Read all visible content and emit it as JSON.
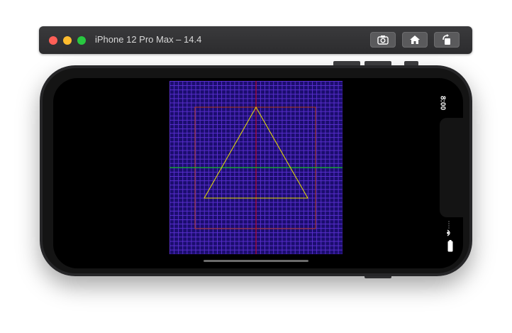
{
  "window": {
    "title": "iPhone 12 Pro Max – 14.4",
    "toolbar": {
      "screenshot_icon": "camera-icon",
      "home_icon": "home-icon",
      "rotate_icon": "rotate-icon"
    }
  },
  "status_bar": {
    "time": "8:00",
    "wifi_icon": "wifi-icon",
    "battery_icon": "battery-icon"
  },
  "colors": {
    "grid_background": "#1b0d6e",
    "grid_lines": "#5a2fd0",
    "x_axis": "#00e000",
    "y_axis": "#c00000",
    "triangle": "#e8e000",
    "bounds": "#b33a1a"
  }
}
